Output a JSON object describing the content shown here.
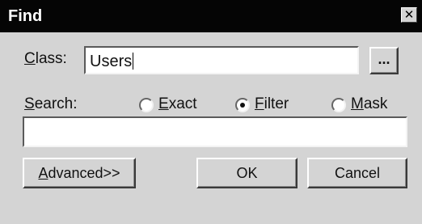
{
  "window": {
    "title": "Find",
    "close_symbol": "✕"
  },
  "class_field": {
    "label_first": "C",
    "label_rest": "lass:",
    "value": "Users",
    "browse_label": "..."
  },
  "search": {
    "label_first": "S",
    "label_rest": "earch:",
    "value": "",
    "options": [
      {
        "first": "E",
        "rest": "xact",
        "selected": false
      },
      {
        "first": "F",
        "rest": "ilter",
        "selected": true
      },
      {
        "first": "M",
        "rest": "ask",
        "selected": false
      }
    ]
  },
  "buttons": {
    "advanced_first": "A",
    "advanced_rest": "dvanced>>",
    "ok": "OK",
    "cancel": "Cancel"
  }
}
